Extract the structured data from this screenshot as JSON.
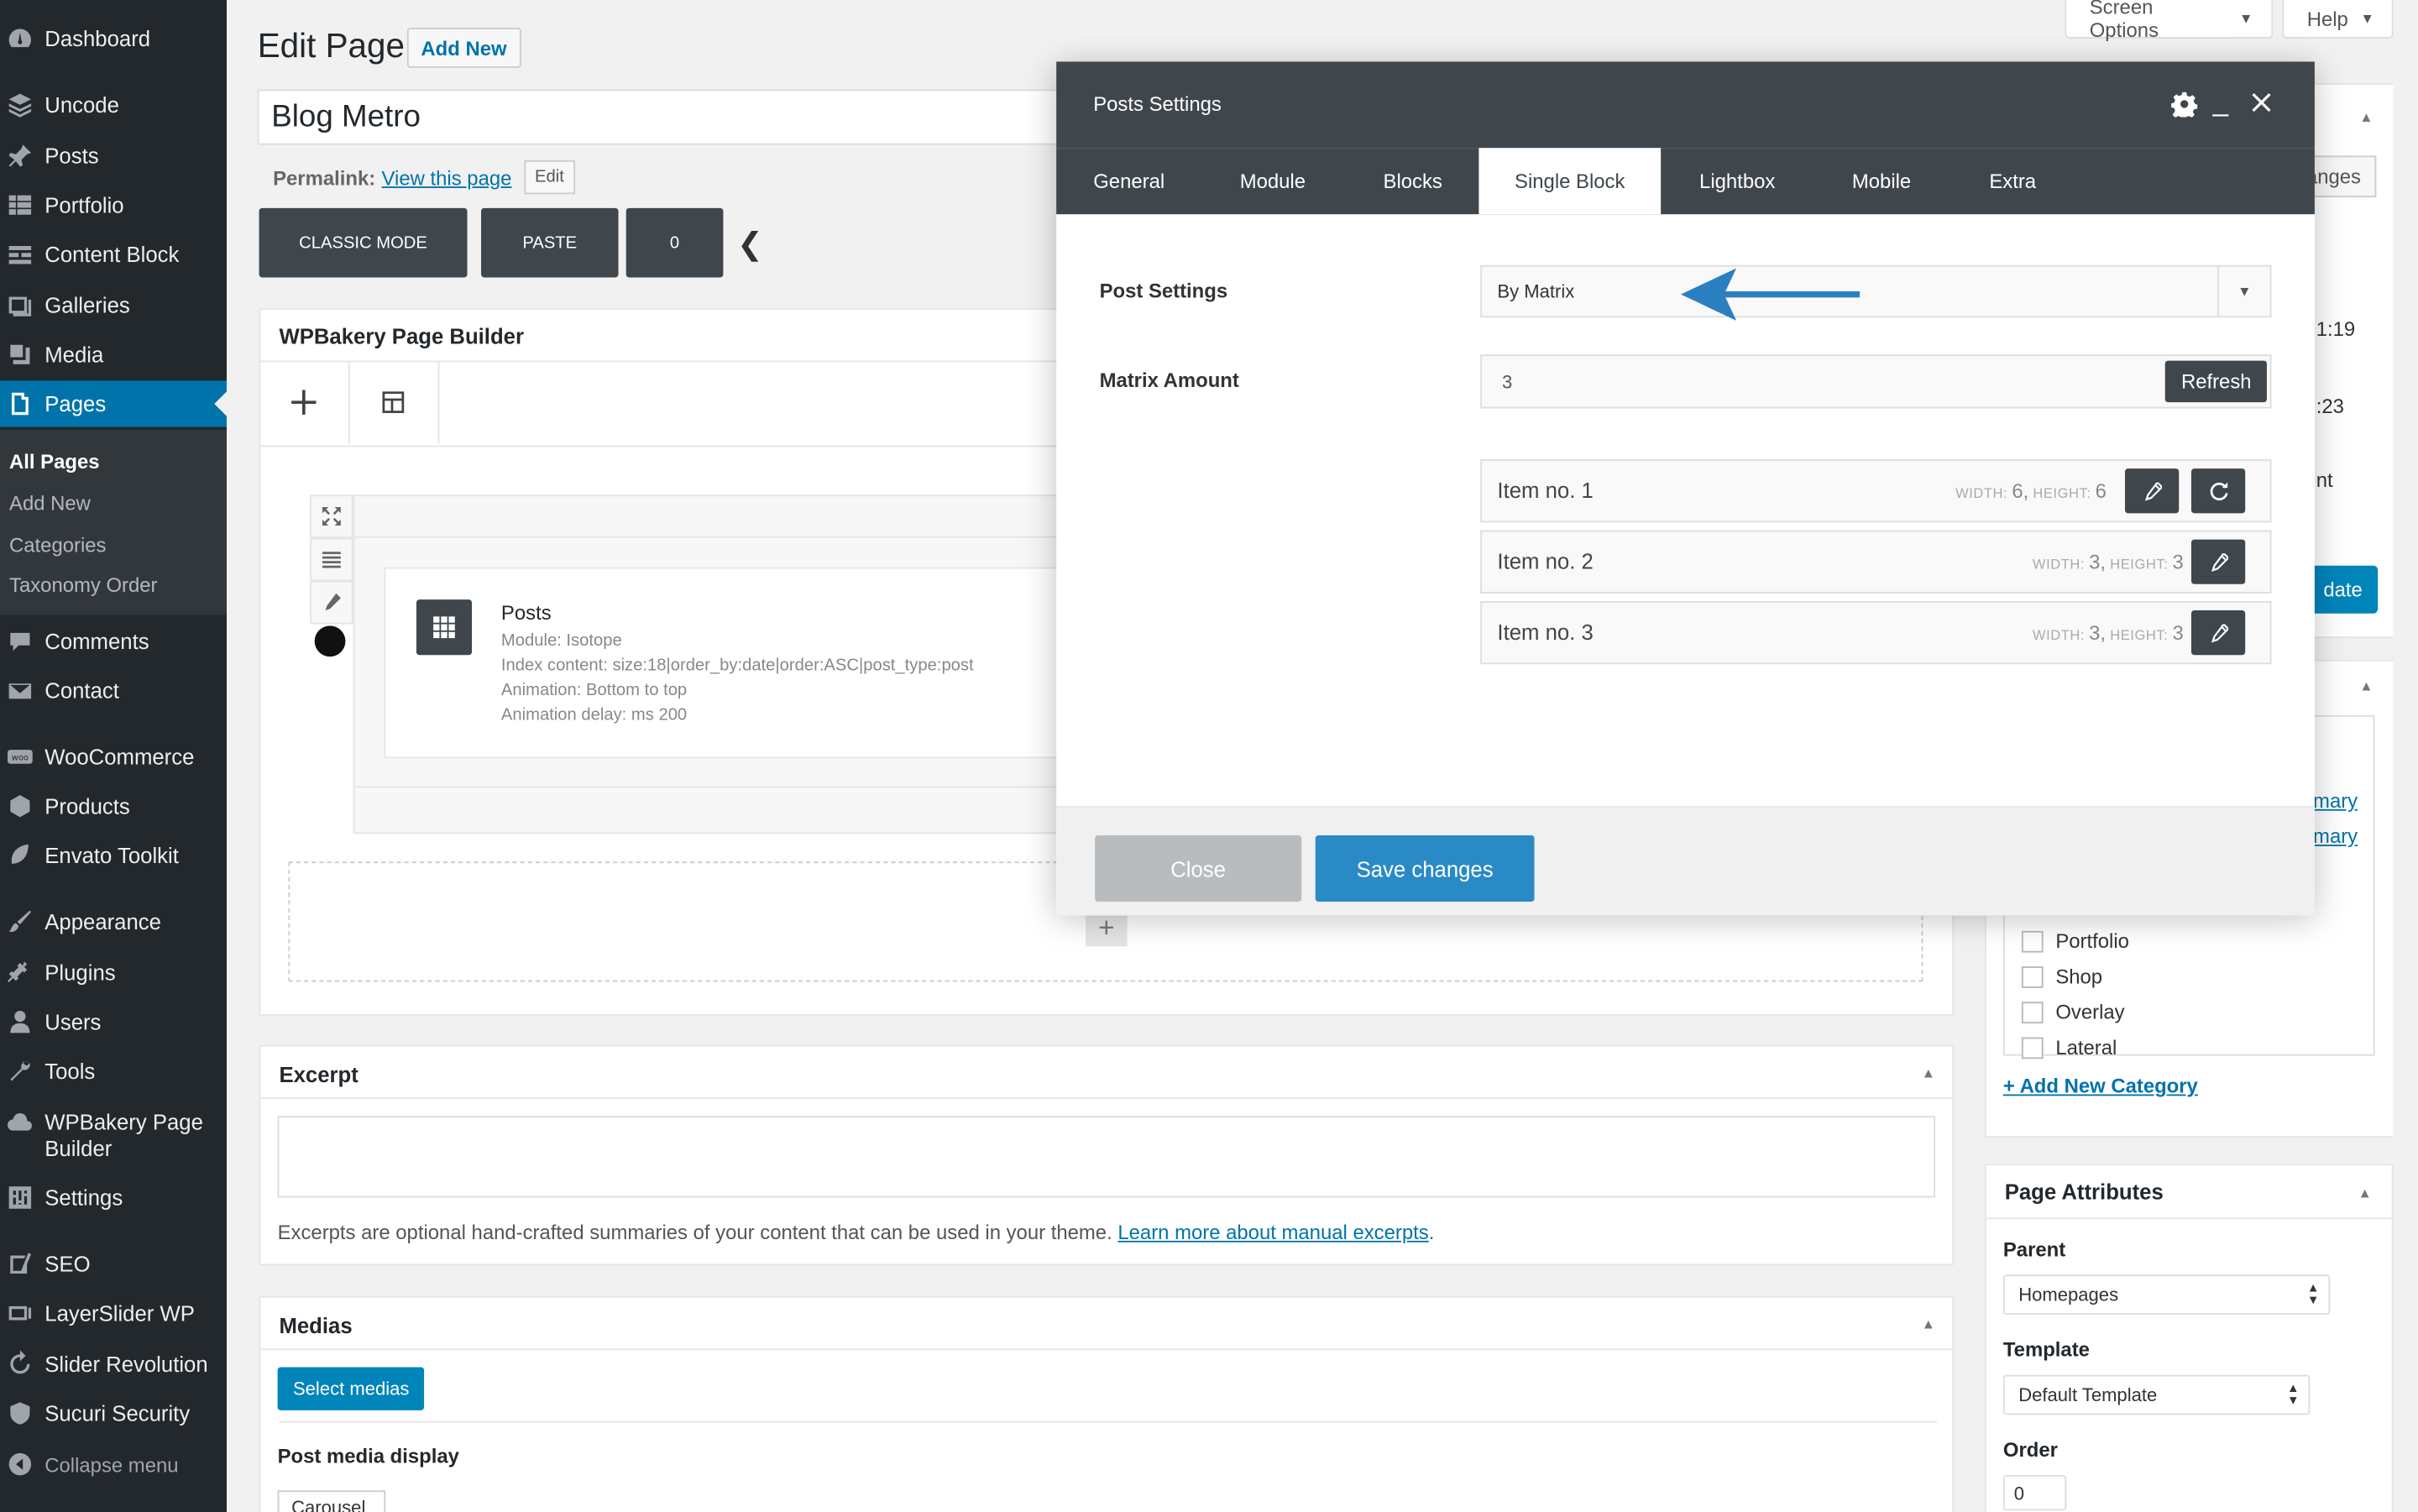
{
  "sidebar": {
    "items": [
      {
        "label": "Dashboard",
        "icon": "dashboard-icon"
      },
      {
        "label": "Uncode",
        "icon": "layers-icon"
      },
      {
        "label": "Posts",
        "icon": "pin-icon"
      },
      {
        "label": "Portfolio",
        "icon": "grid-icon"
      },
      {
        "label": "Content Block",
        "icon": "blocks-icon"
      },
      {
        "label": "Galleries",
        "icon": "gallery-icon"
      },
      {
        "label": "Media",
        "icon": "media-icon"
      },
      {
        "label": "Pages",
        "icon": "pages-icon"
      },
      {
        "label": "Comments",
        "icon": "comments-icon"
      },
      {
        "label": "Contact",
        "icon": "mail-icon"
      },
      {
        "label": "WooCommerce",
        "icon": "woo-icon"
      },
      {
        "label": "Products",
        "icon": "box-icon"
      },
      {
        "label": "Envato Toolkit",
        "icon": "leaf-icon"
      },
      {
        "label": "Appearance",
        "icon": "brush-icon"
      },
      {
        "label": "Plugins",
        "icon": "plug-icon"
      },
      {
        "label": "Users",
        "icon": "user-icon"
      },
      {
        "label": "Tools",
        "icon": "wrench-icon"
      },
      {
        "label": "WPBakery Page Builder",
        "icon": "cloud-icon"
      },
      {
        "label": "Settings",
        "icon": "settings-icon"
      },
      {
        "label": "SEO",
        "icon": "seo-icon"
      },
      {
        "label": "LayerSlider WP",
        "icon": "slider-icon"
      },
      {
        "label": "Slider Revolution",
        "icon": "refresh-icon"
      },
      {
        "label": "Sucuri Security",
        "icon": "shield-icon"
      },
      {
        "label": "Collapse menu",
        "icon": "collapse-icon"
      }
    ],
    "submenu": [
      "All Pages",
      "Add New",
      "Categories",
      "Taxonomy Order"
    ]
  },
  "top": {
    "screen_options": "Screen Options",
    "help": "Help",
    "page_heading": "Edit Page",
    "add_new": "Add New",
    "post_title": "Blog Metro",
    "permalink_label": "Permalink:",
    "permalink_link": "View this page",
    "permalink_edit": "Edit",
    "classic_mode": "CLASSIC MODE",
    "paste": "PASTE",
    "counter": "0"
  },
  "builder": {
    "title": "WPBakery Page Builder",
    "element_title": "Posts",
    "meta": [
      "Module: Isotope",
      "Index content: size:18|order_by:date|order:ASC|post_type:post",
      "Animation: Bottom to top",
      "Animation delay: ms 200"
    ]
  },
  "modal": {
    "title": "Posts Settings",
    "tabs": [
      "General",
      "Module",
      "Blocks",
      "Single Block",
      "Lightbox",
      "Mobile",
      "Extra"
    ],
    "active_tab": "Single Block",
    "post_settings_label": "Post Settings",
    "post_settings_value": "By Matrix",
    "matrix_amount_label": "Matrix Amount",
    "matrix_amount_value": "3",
    "refresh": "Refresh",
    "width_label": "WIDTH:",
    "height_label": "HEIGHT:",
    "items": [
      {
        "name": "Item no. 1",
        "width": "6,",
        "height": "6"
      },
      {
        "name": "Item no. 2",
        "width": "3,",
        "height": "3"
      },
      {
        "name": "Item no. 3",
        "width": "3,",
        "height": "3"
      }
    ],
    "close": "Close",
    "save": "Save changes",
    "accent_color": "#2a8ac6"
  },
  "right": {
    "changes_fragment": "anges",
    "time1": "1:19",
    "time2": ":23",
    "nt_fragment": "nt",
    "update_fragment": "date",
    "mary1": "mary",
    "mary2": "mary",
    "categories": [
      "Portfolio",
      "Shop",
      "Overlay",
      "Lateral"
    ],
    "add_category": "+ Add New Category",
    "page_attributes": "Page Attributes",
    "parent_label": "Parent",
    "parent_value": "Homepages",
    "template_label": "Template",
    "template_value": "Default Template",
    "order_label": "Order",
    "order_value": "0"
  },
  "excerpt": {
    "title": "Excerpt",
    "help": "Excerpts are optional hand-crafted summaries of your content that can be used in your theme.",
    "link": "Learn more about manual excerpts",
    "period": "."
  },
  "medias": {
    "title": "Medias",
    "select": "Select medias",
    "display_label": "Post media display",
    "display_value": "Carousel"
  }
}
